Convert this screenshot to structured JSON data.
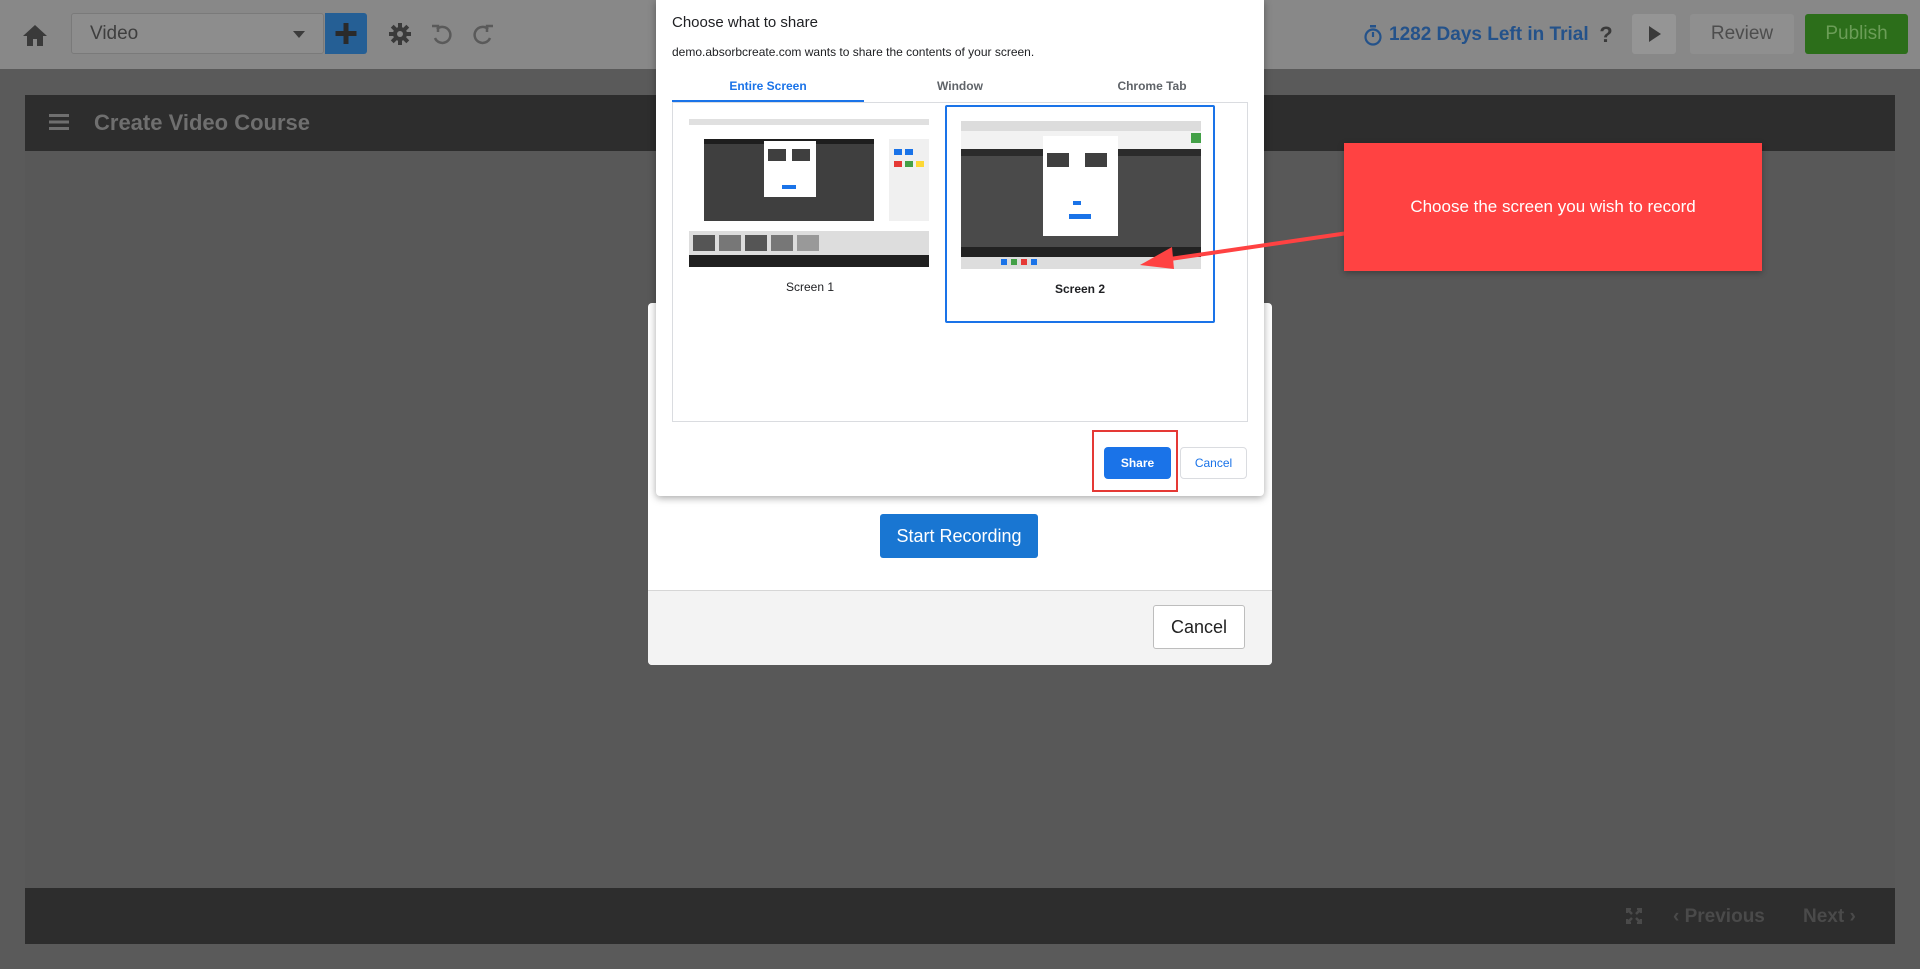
{
  "toolbar": {
    "course_type_value": "Video",
    "trial_text": "1282 Days Left in Trial",
    "help_label": "?",
    "review_label": "Review",
    "publish_label": "Publish"
  },
  "course": {
    "title": "Create Video Course",
    "prev_label": "Previous",
    "next_label": "Next"
  },
  "record_modal": {
    "start_label": "Start Recording",
    "cancel_label": "Cancel"
  },
  "share_dialog": {
    "title": "Choose what to share",
    "subtitle": "demo.absorbcreate.com wants to share the contents of your screen.",
    "tabs": [
      {
        "label": "Entire Screen",
        "active": true
      },
      {
        "label": "Window",
        "active": false
      },
      {
        "label": "Chrome Tab",
        "active": false
      }
    ],
    "screens": [
      {
        "label": "Screen 1",
        "selected": false
      },
      {
        "label": "Screen 2",
        "selected": true
      }
    ],
    "share_label": "Share",
    "cancel_label": "Cancel"
  },
  "callout": {
    "text": "Choose the screen you wish to record"
  },
  "colors": {
    "primary_blue": "#1976d2",
    "chrome_blue": "#1a73e8",
    "callout_red": "#ff4242",
    "publish_green": "#2c6e1a"
  }
}
